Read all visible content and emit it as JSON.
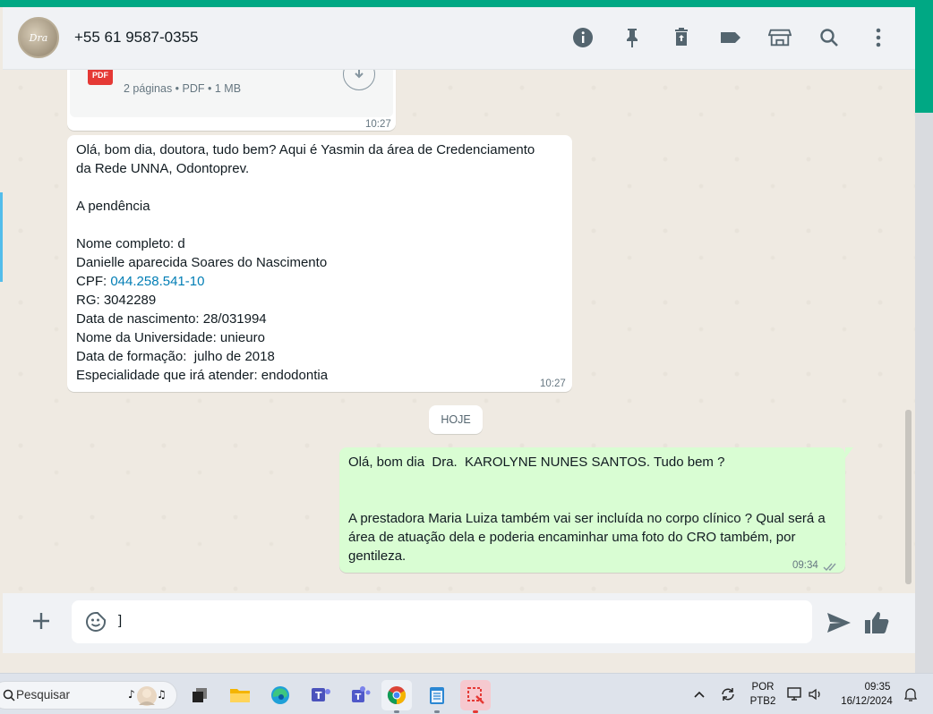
{
  "header": {
    "contact_name": "+55 61 9587-0355",
    "avatar_text": "Dra"
  },
  "document": {
    "icon_label": "PDF",
    "meta": "2 páginas • PDF • 1 MB",
    "time": "10:27"
  },
  "messages": {
    "first": {
      "lines": [
        "Olá, bom dia, doutora, tudo bem? Aqui é Yasmin da área de Credenciamento",
        "da Rede UNNA, Odontoprev.",
        "",
        "A pendência",
        "",
        "Nome completo: d",
        "Danielle aparecida Soares do Nascimento",
        "CPF: ",
        "RG: 3042289",
        "Data de nascimento: 28/031994",
        "Nome da Universidade: unieuro",
        "Data de formação:  julho de 2018",
        "Especialidade que irá atender: endodontia"
      ],
      "cpf_link": "044.258.541-10",
      "time": "10:27"
    },
    "date_divider": "HOJE",
    "second": {
      "lines": [
        "Olá, bom dia  Dra.  KAROLYNE NUNES SANTOS. Tudo bem ?",
        "",
        "",
        "A prestadora Maria Luiza também vai ser incluída no corpo clínico ? Qual será a",
        "área de atuação dela e poderia encaminhar uma foto do CRO também, por",
        "gentileza."
      ],
      "time": "09:34",
      "status": "read"
    }
  },
  "composer": {
    "value": "]"
  },
  "taskbar": {
    "search_placeholder": "Pesquisar",
    "language": "POR",
    "layout": "PTB2",
    "time": "09:35",
    "date": "16/12/2024"
  },
  "colors": {
    "accent": "#00a884",
    "outgoing_bubble": "#d9fdd3",
    "link": "#027eb5"
  }
}
